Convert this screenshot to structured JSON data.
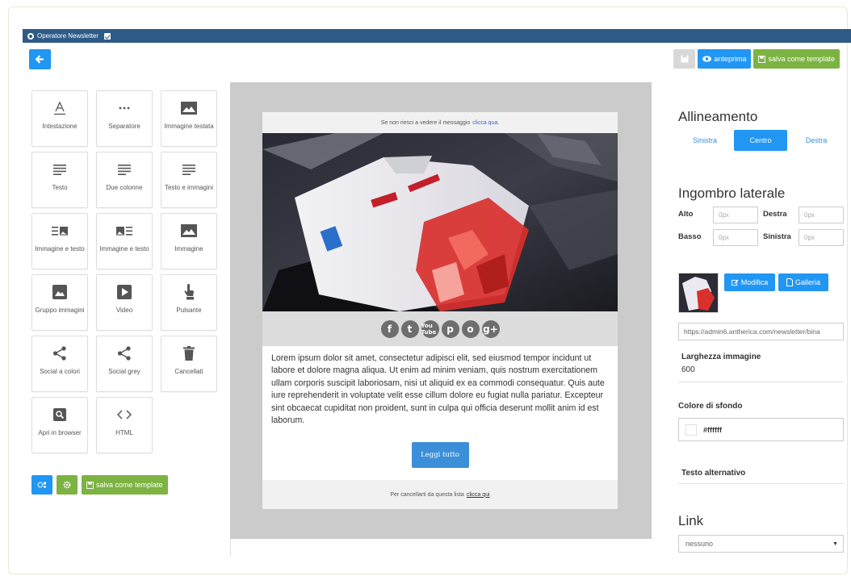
{
  "window": {
    "title": "Operatore Newsletter"
  },
  "toolbar": {
    "preview_label": "anteprima",
    "save_template_label": "salva come template"
  },
  "blocks": [
    {
      "label": "Intestazione",
      "icon": "heading-icon"
    },
    {
      "label": "Separatore",
      "icon": "separator-icon"
    },
    {
      "label": "Immagine testata",
      "icon": "image-icon"
    },
    {
      "label": "Testo",
      "icon": "text-icon"
    },
    {
      "label": "Due colonne",
      "icon": "two-columns-icon"
    },
    {
      "label": "Testo e immagini",
      "icon": "text-icon"
    },
    {
      "label": "Immagine e testo",
      "icon": "image-text-icon"
    },
    {
      "label": "Immagine e testo",
      "icon": "text-image-icon"
    },
    {
      "label": "Immagine",
      "icon": "image-icon"
    },
    {
      "label": "Gruppo immagini",
      "icon": "gallery-icon"
    },
    {
      "label": "Video",
      "icon": "video-icon"
    },
    {
      "label": "Pulsante",
      "icon": "pointer-icon"
    },
    {
      "label": "Social a colori",
      "icon": "share-icon"
    },
    {
      "label": "Social grey",
      "icon": "share-icon"
    },
    {
      "label": "Cancellati",
      "icon": "trash-icon"
    },
    {
      "label": "Apri in browser",
      "icon": "search-icon"
    },
    {
      "label": "HTML",
      "icon": "code-icon"
    }
  ],
  "bottom_toolbar": {
    "save_template_label": "salva come template"
  },
  "email": {
    "header_text": "Se non riesci a vedere il messaggio",
    "header_link": "clicca qua.",
    "social": [
      "f",
      "t",
      "You Tube",
      "p",
      "o",
      "g+"
    ],
    "body": "Lorem ipsum dolor sit amet, consectetur adipisci elit, sed eiusmod tempor incidunt ut labore et dolore magna aliqua. Ut enim ad minim veniam, quis nostrum exercitationem ullam corporis suscipit laboriosam, nisi ut aliquid ex ea commodi consequatur. Quis aute iure reprehenderit in voluptate velit esse cillum dolore eu fugiat nulla pariatur. Excepteur sint obcaecat cupiditat non proident, sunt in culpa qui officia deserunt mollit anim id est laborum.",
    "button_label": "Leggi tutto",
    "footer_text": "Per cancellarti da questa lista",
    "footer_link": "clicca qui"
  },
  "panel": {
    "alignment_title": "Allineamento",
    "align_left": "Sinistra",
    "align_center": "Centro",
    "align_right": "Destra",
    "margin_title": "Ingombro laterale",
    "top_label": "Alto",
    "right_label": "Destra",
    "bottom_label": "Basso",
    "left_label": "Sinistra",
    "top_placeholder": "0px",
    "right_placeholder": "0px",
    "bottom_placeholder": "0px",
    "left_placeholder": "0px",
    "edit_label": "Modifica",
    "gallery_label": "Galleria",
    "image_url": "https://admin6.antherica.com/newsletter/bina",
    "image_width_label": "Larghezza immagine",
    "image_width_value": "600",
    "bg_color_label": "Colore di sfondo",
    "bg_color_value": "#ffffff",
    "alt_text_label": "Testo alternativo",
    "link_title": "Link",
    "link_value": "nessuno"
  },
  "colors": {
    "titlebar": "#2e5a87",
    "primary": "#2196f3",
    "success": "#7cb342",
    "canvas": "#cbcbcb"
  }
}
